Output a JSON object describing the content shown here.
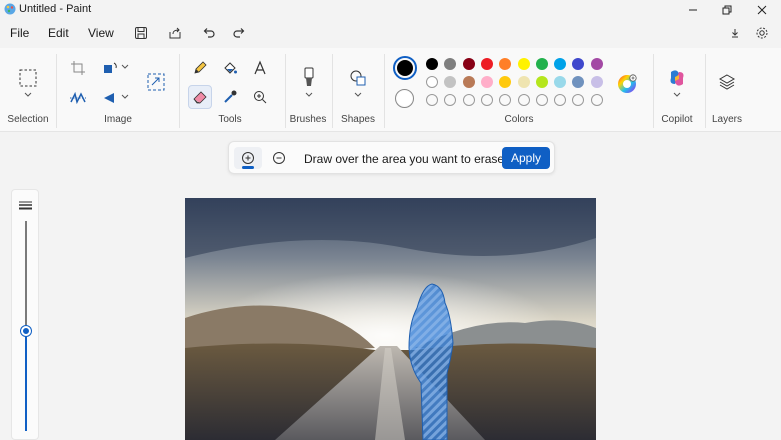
{
  "window": {
    "title": "Untitled - Paint"
  },
  "menu": {
    "file": "File",
    "edit": "Edit",
    "view": "View"
  },
  "ribbon": {
    "groups": {
      "selection": "Selection",
      "image": "Image",
      "tools": "Tools",
      "brushes": "Brushes",
      "shapes": "Shapes",
      "colors": "Colors",
      "copilot": "Copilot",
      "layers": "Layers"
    },
    "colors_row1": [
      "#000000",
      "#7f7f7f",
      "#880015",
      "#ed1c24",
      "#ff7f27",
      "#fff200",
      "#22b14c",
      "#00a2e8",
      "#3f48cc",
      "#a349a4"
    ],
    "colors_row2": [
      "#ffffff",
      "#c3c3c3",
      "#b97a57",
      "#ffaec9",
      "#ffc90e",
      "#efe4b0",
      "#b5e61d",
      "#99d9ea",
      "#7092be",
      "#c8bfe7"
    ],
    "primary_color": "#000000",
    "secondary_color": "#ffffff"
  },
  "erase_bar": {
    "instruction": "Draw over the area you want to erase",
    "apply_label": "Apply"
  },
  "accent_color": "#0f5fc4"
}
